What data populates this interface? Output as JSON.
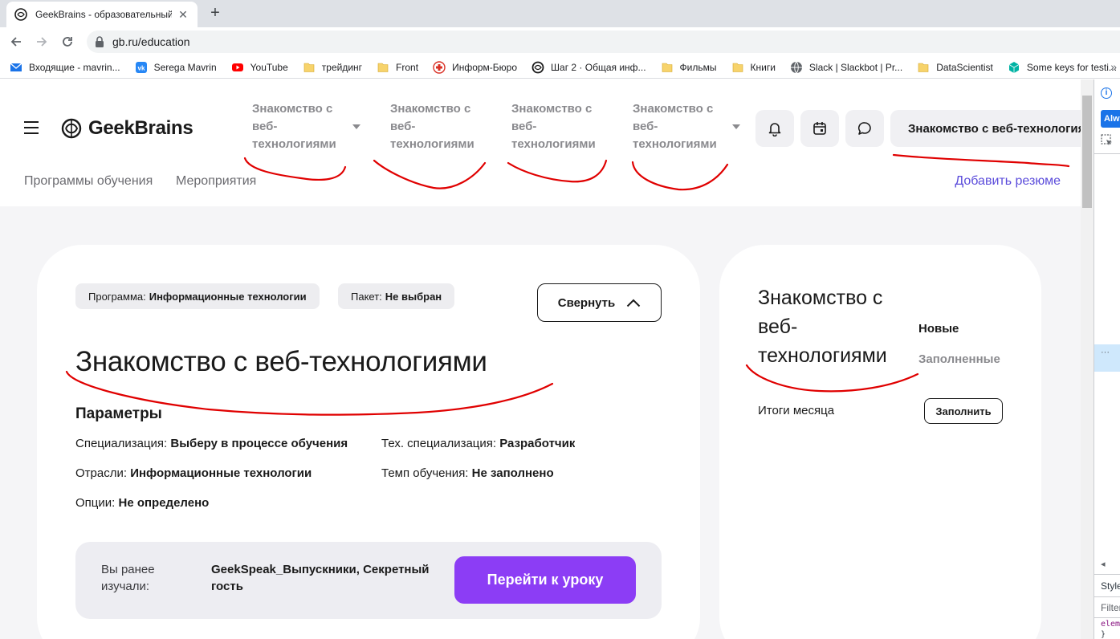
{
  "browser": {
    "tab_title": "GeekBrains - образовательный п",
    "url": "gb.ru/education",
    "bookmarks": [
      {
        "label": "Входящие - mavrin...",
        "icon": "mail-icon",
        "color": "#1a73e8"
      },
      {
        "label": "Serega Mavrin",
        "icon": "vk-icon",
        "color": "#2787f5"
      },
      {
        "label": "YouTube",
        "icon": "youtube-icon",
        "color": "#ff0000"
      },
      {
        "label": "трейдинг",
        "icon": "folder-icon",
        "color": "#f7d36b"
      },
      {
        "label": "Front",
        "icon": "folder-icon",
        "color": "#f7d36b"
      },
      {
        "label": "Информ-Бюро",
        "icon": "red-cross-icon",
        "color": "#d93025"
      },
      {
        "label": "Шаг 2 · Общая инф...",
        "icon": "geekbrains-icon",
        "color": "#1a1a1a"
      },
      {
        "label": "Фильмы",
        "icon": "folder-icon",
        "color": "#f7d36b"
      },
      {
        "label": "Книги",
        "icon": "folder-icon",
        "color": "#f7d36b"
      },
      {
        "label": "Slack | Slackbot | Pr...",
        "icon": "globe-icon",
        "color": "#5f6368"
      },
      {
        "label": "DataScientist",
        "icon": "folder-icon",
        "color": "#f7d36b"
      },
      {
        "label": "Some keys for testi...",
        "icon": "cube-icon",
        "color": "#00b3a4"
      }
    ]
  },
  "header": {
    "logo": "GeekBrains",
    "nav": [
      {
        "label": "Знакомство с веб-технологиями",
        "has_dropdown": true
      },
      {
        "label": "Знакомство с веб-технологиями",
        "has_dropdown": false
      },
      {
        "label": "Знакомство с веб-технологиями",
        "has_dropdown": false
      },
      {
        "label": "Знакомство с веб-технологиями",
        "has_dropdown": true
      }
    ],
    "icons": [
      "bell-icon",
      "calendar-icon",
      "chat-icon"
    ],
    "course_select": "Знакомство с веб-технологиями",
    "subnav": [
      "Программы обучения",
      "Мероприятия"
    ],
    "add_resume": "Добавить резюме"
  },
  "main_card": {
    "chip_program_label": "Программа:",
    "chip_program_value": "Информационные технологии",
    "chip_package_label": "Пакет:",
    "chip_package_value": "Не выбран",
    "collapse_label": "Свернуть",
    "title": "Знакомство с веб-технологиями",
    "params_title": "Параметры",
    "params": {
      "specialization_label": "Специализация:",
      "specialization_value": "Выберу в процессе обучения",
      "tech_label": "Тех. специализация:",
      "tech_value": "Разработчик",
      "industries_label": "Отрасли:",
      "industries_value": "Информационные технологии",
      "pace_label": "Темп обучения:",
      "pace_value": "Не заполнено",
      "options_label": "Опции:",
      "options_value": "Не определено"
    },
    "lesson": {
      "label": "Вы ранее изучали:",
      "value": "GeekSpeak_Выпускники, Секретный гость",
      "button": "Перейти к уроку"
    }
  },
  "side_card": {
    "title": "Знакомство с веб-технологиями",
    "tab_new": "Новые",
    "tab_filled": "Заполненные",
    "month_label": "Итоги месяца",
    "fill_button": "Заполнить"
  },
  "devtools": {
    "always_label": "Alw",
    "styles_label": "Style",
    "filter_label": "Filter",
    "element_label": "eleme",
    "brace": "}"
  },
  "colors": {
    "accent_purple": "#8c3df5",
    "link_blue": "#5b4cdb",
    "annotation_red": "#e00000",
    "page_bg": "#f5f5f7"
  }
}
